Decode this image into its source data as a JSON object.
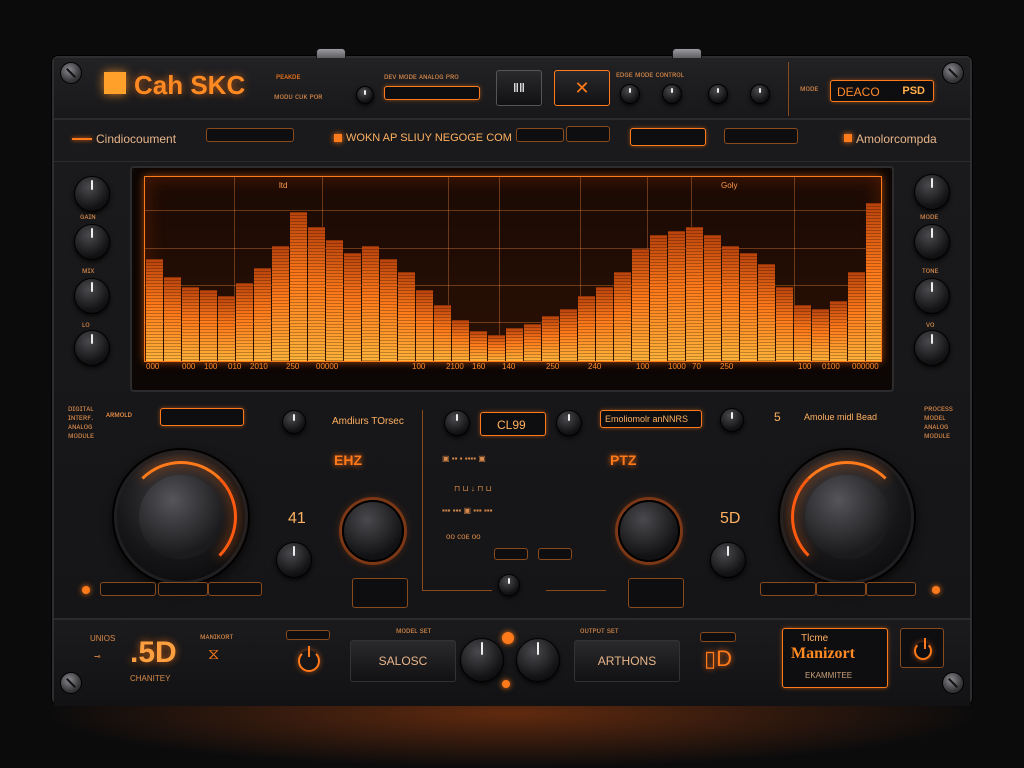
{
  "brand": {
    "title": "Cah SKC"
  },
  "header": {
    "logo_sub_text": "ᴘᴇᴀᴋᴅᴇ",
    "close_symbol": "✕",
    "right_box_left": "DEACO",
    "right_box_right": "PSD"
  },
  "strip": {
    "left_label": "Cindiocoument",
    "center_label": "WOKN AP SLIUY NEGOGE COM",
    "right_label": "Amolorcompda"
  },
  "screen": {
    "top_label_left": "ltd",
    "top_label_right": "Goly",
    "ticks": [
      "000",
      "000",
      "100",
      "010",
      "2010",
      "250",
      "00000",
      "100",
      "2100",
      "160",
      "140",
      "250",
      "240",
      "100",
      "1000",
      "70",
      "250",
      "100",
      "0100",
      "000000"
    ]
  },
  "controls": {
    "left_center_label": "Amdiurs TOrsec",
    "center_display": "CL99",
    "right_center_label": "Emoliomolr anNNRS",
    "left_value": "41",
    "right_value": "5D",
    "left_section": "EHZ",
    "right_section": "PTZ",
    "right_corner_label": "Amolue midl Bead",
    "right_corner_num": "5"
  },
  "bottom": {
    "value_display": ".5D",
    "value_caption": "CHANITEY",
    "left_label": "UNIOS",
    "center_left_button": "SALOSC",
    "center_right_button": "ARTHONS",
    "brand_name_small": "Tlcme",
    "brand_name": "Manizort",
    "brand_caption": "EKAMMITEE"
  },
  "colors": {
    "accent": "#ff7a1a",
    "panel": "#18181a",
    "screen_bg": "#1a0a04"
  }
}
